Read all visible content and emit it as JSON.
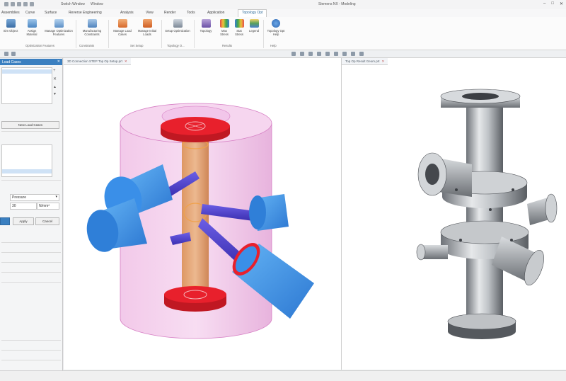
{
  "titlebar": {
    "window_menu": "Switch Window",
    "window_dropdown": "Window",
    "title": "Siemens NX - Modeling"
  },
  "tabs": [
    "Assemblies",
    "Curve",
    "Surface",
    "Reverse Engineering",
    "Analysis",
    "View",
    "Render",
    "Tools",
    "Application",
    "Topology Opt"
  ],
  "active_tab_index": 9,
  "ribbon": {
    "buttons": [
      {
        "label": "Sim Object",
        "icon": "stack-icon"
      },
      {
        "label": "Assign Material",
        "icon": "cube-material-icon"
      },
      {
        "label": "Manage Optimization Features",
        "icon": "settings-doc-icon"
      },
      {
        "label": "Manufacturing Constraints",
        "icon": "gear-icon"
      },
      {
        "label": "Manage Load Cases",
        "icon": "arrows-icon"
      },
      {
        "label": "Manage Initial Loads",
        "icon": "arrows-icon"
      },
      {
        "label": "Setup Optimization",
        "icon": "tool-icon"
      },
      {
        "label": "Topology",
        "icon": "topology-icon"
      },
      {
        "label": "Max Stress",
        "icon": "bars-chart-icon"
      },
      {
        "label": "Stat Stress",
        "icon": "bars-chart-icon"
      },
      {
        "label": "Legend",
        "icon": "legend-icon"
      },
      {
        "label": "Topology Opt Help",
        "icon": "help-icon"
      }
    ],
    "groups": [
      "Optimization Features",
      "Constraints",
      "Set Setup",
      "Topology O...",
      "Results",
      "Help"
    ]
  },
  "left_panel": {
    "title": "Load Cases",
    "new_button": "New Load Cases",
    "dropdown_value": "Pressure",
    "field_value": "30",
    "unit_value": "N/mm²",
    "apply_button": "Apply",
    "cancel_button": "Cancel"
  },
  "viewport1": {
    "tab_label": "3D Connection STEP Top Op Setup.prt"
  },
  "viewport2": {
    "tab_label": "Top Op Result Geom.prt"
  },
  "colors": {
    "accent": "#3a7fc0",
    "design_space": "#e8a0d8",
    "core": "#d9893a",
    "pipes": "#3a8fe8",
    "fixed_face": "#e8202c"
  }
}
